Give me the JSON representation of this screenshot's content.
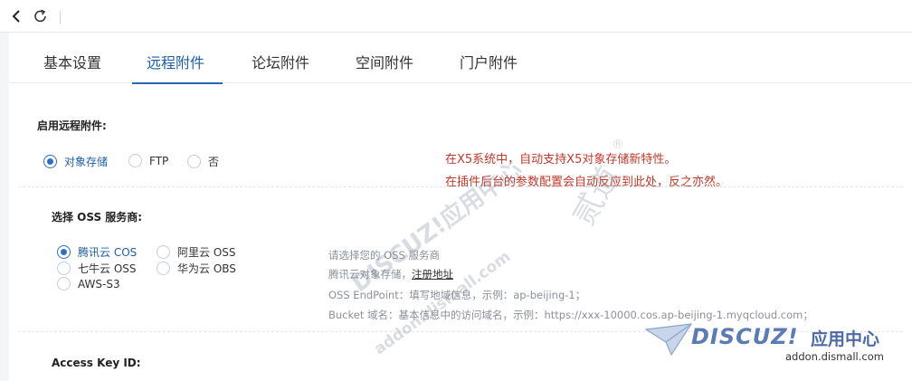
{
  "tabs": [
    "基本设置",
    "远程附件",
    "论坛附件",
    "空间附件",
    "门户附件"
  ],
  "remote": {
    "label": "启用远程附件:",
    "options": [
      "对象存储",
      "FTP",
      "否"
    ]
  },
  "note": {
    "line1": "在X5系统中，自动支持X5对象存储新特性。",
    "line2": "在插件后台的参数配置会自动反应到此处，反之亦然。"
  },
  "oss": {
    "label": "选择 OSS 服务商:",
    "options": [
      "腾讯云 COS",
      "阿里云 OSS",
      "七牛云 OSS",
      "华为云 OBS",
      "AWS-S3"
    ],
    "help": {
      "line1": "请选择您的 OSS 服务商",
      "line2_prefix": "腾讯云对象存储，",
      "register_link": "注册地址",
      "line3": "OSS EndPoint：填写地域信息，示例：ap-beijing-1；",
      "line4": "Bucket 域名：基本信息中的访问域名，示例：https://xxx-10000.cos.ap-beijing-1.myqcloud.com；"
    }
  },
  "access_key": {
    "label": "Access Key ID:"
  },
  "watermark": {
    "text1": "DISCUZ!应用中心",
    "text2": "addon.dismall.com",
    "text3": "贰道",
    "text4": "®",
    "brand": "DISCUZ!",
    "center": "应用中心",
    "url": "addon.dismall.com"
  },
  "colors": {
    "accent": "#2f6fc2",
    "note": "#c0392b"
  }
}
